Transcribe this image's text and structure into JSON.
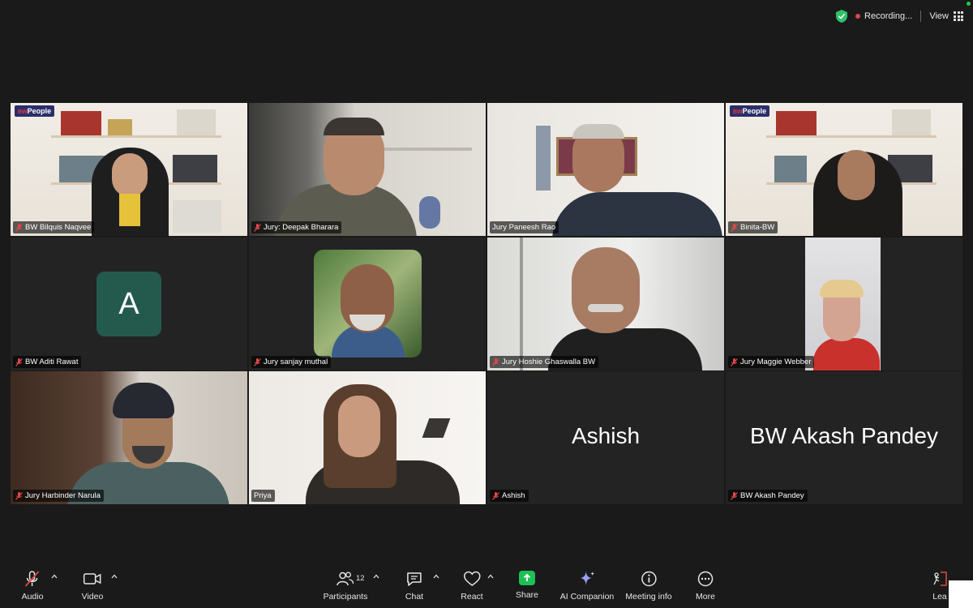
{
  "topbar": {
    "recording_label": "Recording...",
    "view_label": "View"
  },
  "participants": [
    {
      "name": "BW Bilquis Naqvee",
      "muted": true,
      "logo": "BWPeople"
    },
    {
      "name": "Jury: Deepak Bharara",
      "muted": true
    },
    {
      "name": "Jury Paneesh Rao",
      "muted": false
    },
    {
      "name": "Binita-BW",
      "muted": true,
      "logo": "BWPeople"
    },
    {
      "name": "BW Aditi Rawat",
      "muted": true,
      "avatar_letter": "A"
    },
    {
      "name": "Jury sanjay muthal",
      "muted": true
    },
    {
      "name": "Jury Hoshie Ghaswalla BW",
      "muted": true
    },
    {
      "name": "Jury Maggie Webber",
      "muted": true
    },
    {
      "name": "Jury Harbinder Narula",
      "muted": true
    },
    {
      "name": "Priya",
      "muted": false,
      "active_speaker": true
    },
    {
      "name": "Ashish",
      "muted": true,
      "display_name": "Ashish"
    },
    {
      "name": "BW Akash Pandey",
      "muted": true,
      "display_name": "BW Akash Pandey"
    }
  ],
  "logo": {
    "prefix": "BW",
    "text": "People"
  },
  "toolbar": {
    "audio": "Audio",
    "video": "Video",
    "participants": "Participants",
    "participants_count": "12",
    "chat": "Chat",
    "react": "React",
    "share": "Share",
    "ai_companion": "AI Companion",
    "meeting_info": "Meeting info",
    "more": "More",
    "leave": "Lea"
  },
  "colors": {
    "background": "#1a1a1a",
    "active_speaker_border": "#2fd154",
    "share_green": "#1fbf57",
    "recording_red": "#e0454a",
    "avatar_green": "#245a4e"
  }
}
